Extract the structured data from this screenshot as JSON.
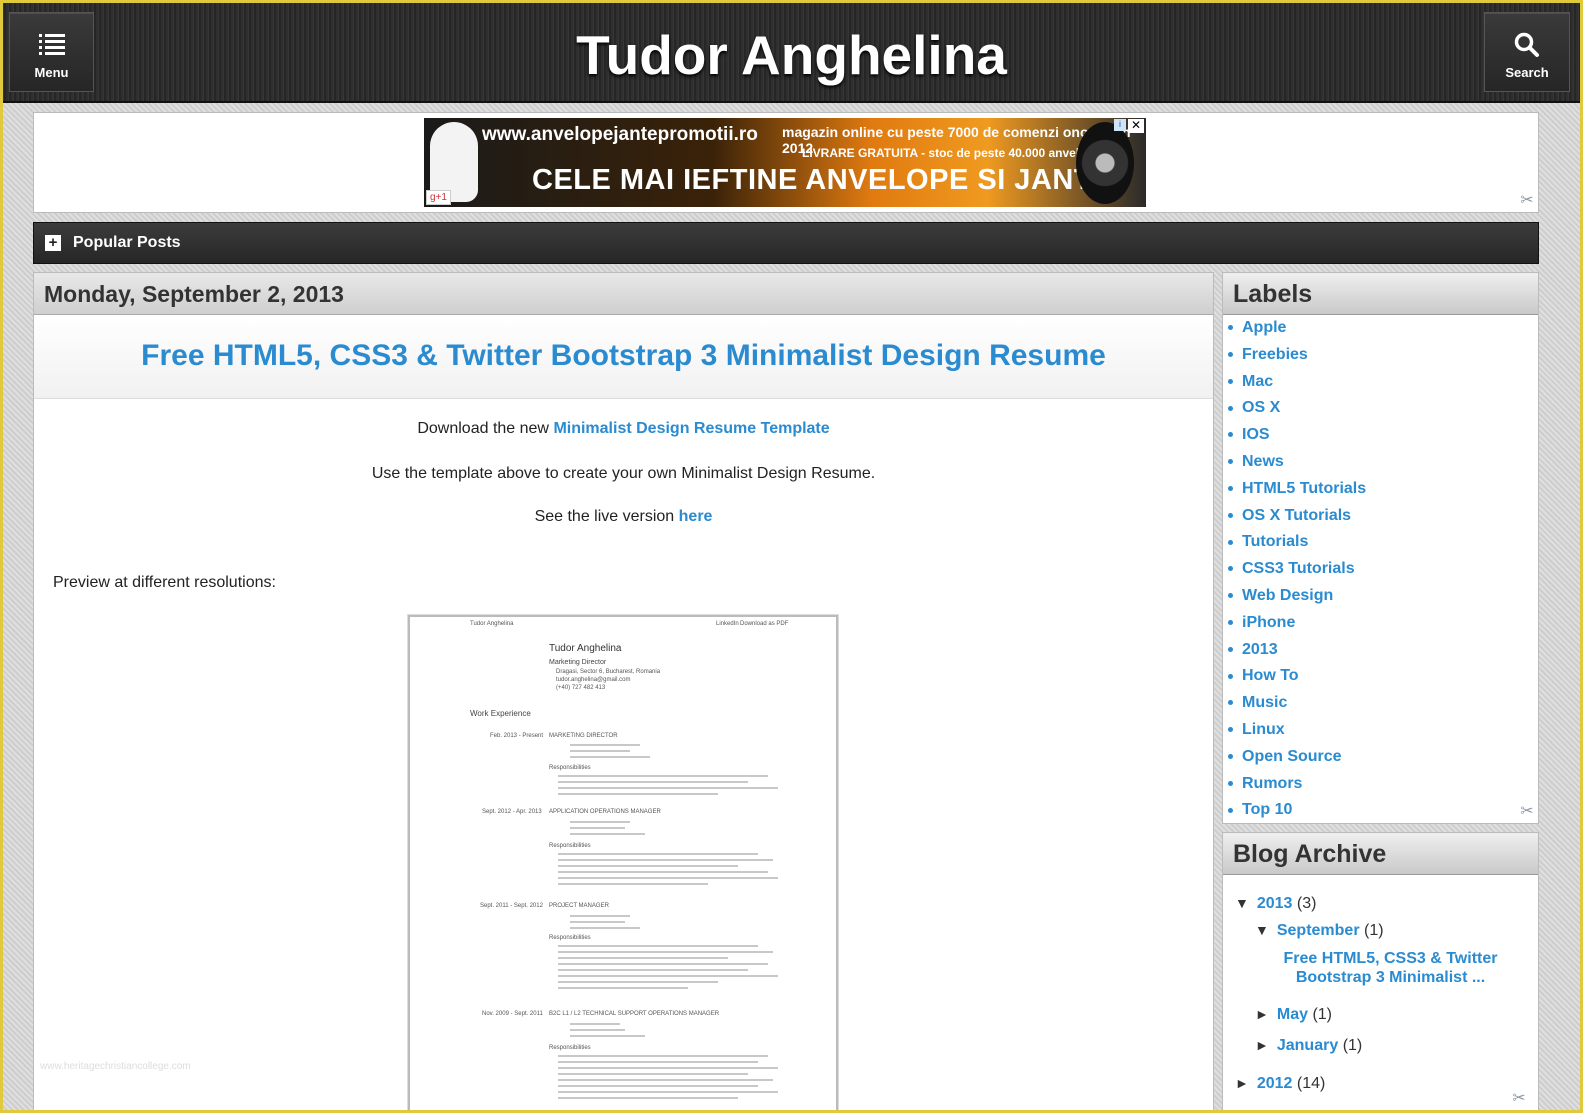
{
  "header": {
    "title": "Tudor Anghelina",
    "menu_label": "Menu",
    "search_label": "Search"
  },
  "ad": {
    "url": "www.anvelopejantepromotii.ro",
    "line1": "magazin online cu peste 7000 de comenzi onorate in 2012",
    "line2": "LIVRARE GRATUITA - stoc de peste 40.000 anvelope",
    "headline": "CELE MAI IEFTINE ANVELOPE SI JANTE",
    "gplus": "g+1",
    "close": "✕",
    "info": "i"
  },
  "popular": {
    "label": "Popular Posts",
    "toggle": "+"
  },
  "post": {
    "date": "Monday, September 2, 2013",
    "title": "Free HTML5, CSS3 & Twitter Bootstrap 3 Minimalist Design Resume",
    "line1_prefix": "Download the new ",
    "line1_link": "Minimalist Design Resume Template",
    "line2": "Use the template above to create your own Minimalist Design Resume.",
    "line3_prefix": "See the live version ",
    "line3_link": "here",
    "preview_label": "Preview at different resolutions:",
    "watermark": "www.heritagechristiancollege.com"
  },
  "resume": {
    "header_left": "Tudor Anghelina",
    "header_right1": "LinkedIn",
    "header_right2": "Download as PDF",
    "name": "Tudor Anghelina",
    "role": "Marketing Director",
    "contact1": "Dragasi, Sector 6, Bucharest, Romania",
    "contact2": "tudor.anghelina@gmail.com",
    "contact3": "(+40) 727 482 413",
    "section": "Work Experience",
    "jobs": [
      {
        "period": "Feb. 2013 - Present",
        "title": "MARKETING DIRECTOR",
        "resp": "Responsibilities"
      },
      {
        "period": "Sept. 2012 - Apr. 2013",
        "title": "APPLICATION OPERATIONS MANAGER",
        "resp": "Responsibilities"
      },
      {
        "period": "Sept. 2011 - Sept. 2012",
        "title": "PROJECT MANAGER",
        "resp": "Responsibilities"
      },
      {
        "period": "Nov. 2009 - Sept. 2011",
        "title": "B2C L1 / L2 TECHNICAL SUPPORT OPERATIONS MANAGER",
        "resp": "Responsibilities"
      }
    ]
  },
  "labels": {
    "title": "Labels",
    "items": [
      "Apple",
      "Freebies",
      "Mac",
      "OS X",
      "IOS",
      "News",
      "HTML5 Tutorials",
      "OS X Tutorials",
      "Tutorials",
      "CSS3 Tutorials",
      "Web Design",
      "iPhone",
      "2013",
      "How To",
      "Music",
      "Linux",
      "Open Source",
      "Rumors",
      "Top 10"
    ]
  },
  "archive": {
    "title": "Blog Archive",
    "y2013": "2013",
    "y2013_count": "(3)",
    "sept": "September",
    "sept_count": "(1)",
    "post": "Free HTML5, CSS3 & Twitter Bootstrap 3 Minimalist ...",
    "may": "May",
    "may_count": "(1)",
    "jan": "January",
    "jan_count": "(1)",
    "y2012": "2012",
    "y2012_count": "(14)",
    "tri_down": "▼",
    "tri_right": "►"
  },
  "icons": {
    "menu": "list-icon",
    "search": "magnifier-icon",
    "tool": "wrench-screwdriver-icon"
  },
  "colors": {
    "link": "#2a8bd0",
    "header": "#2b2b2b",
    "frame": "#e0c93a"
  }
}
